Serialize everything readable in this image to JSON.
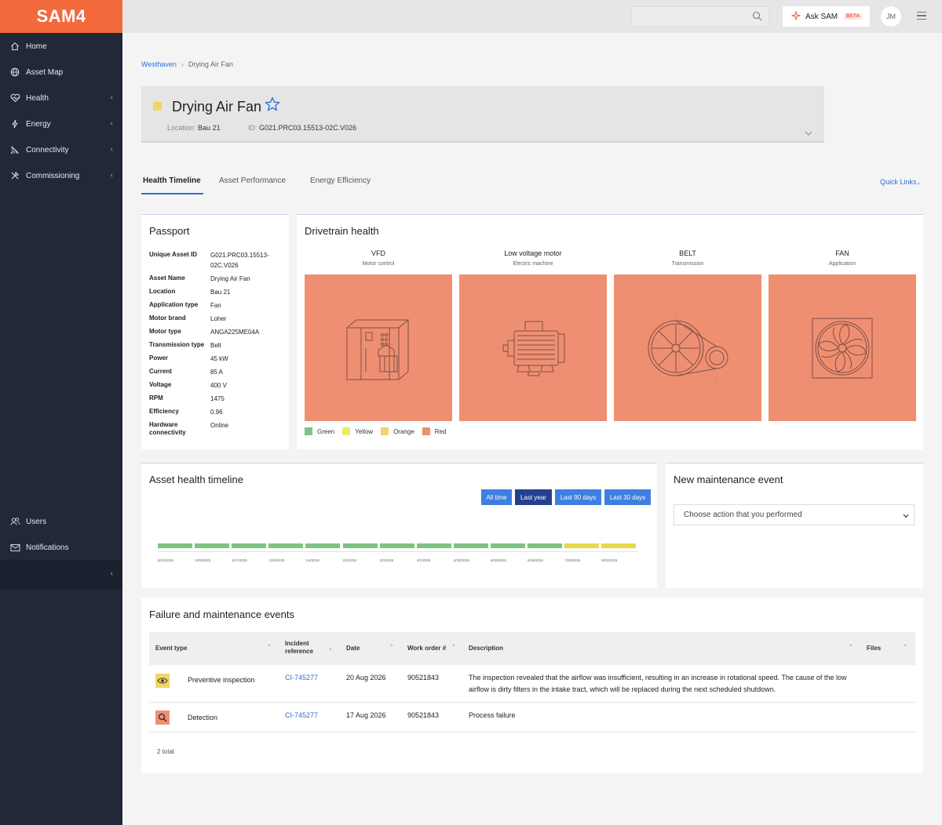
{
  "app": {
    "logo": "SAM4"
  },
  "sidebar": {
    "items": [
      {
        "label": "Home",
        "icon": "home-icon",
        "has_chevron": false
      },
      {
        "label": "Asset Map",
        "icon": "globe-icon",
        "has_chevron": false
      },
      {
        "label": "Health",
        "icon": "heart-pulse-icon",
        "has_chevron": true
      },
      {
        "label": "Energy",
        "icon": "lightning-icon",
        "has_chevron": true
      },
      {
        "label": "Connectivity",
        "icon": "signal-icon",
        "has_chevron": true
      },
      {
        "label": "Commissioning",
        "icon": "tools-icon",
        "has_chevron": true
      }
    ],
    "bottom_items": [
      {
        "label": "Users",
        "icon": "users-icon"
      },
      {
        "label": "Notifications",
        "icon": "mail-icon"
      }
    ],
    "chevron": "‹"
  },
  "topbar": {
    "search_placeholder": "",
    "ask_label": "Ask SAM",
    "beta_badge": "BETA",
    "avatar_initials": "JM"
  },
  "breadcrumb": {
    "parent": "Westhaven",
    "current": "Drying Air Fan"
  },
  "asset": {
    "status_color": "#f1d469",
    "name": "Drying Air Fan",
    "location_label": "Location:",
    "location_value": "Bau 21",
    "id_label": "ID:",
    "id_value": "G021.PRC03.15513-02C.V026"
  },
  "tabs": [
    "Health Timeline",
    "Asset Performance",
    "Energy Efficiency"
  ],
  "quick_links": "Quick Links",
  "passport": {
    "title": "Passport",
    "rows": [
      {
        "label": "Unique Asset ID",
        "value": "G021.PRC03.15513-02C.V026"
      },
      {
        "label": "Asset Name",
        "value": "Drying Air Fan"
      },
      {
        "label": "Location",
        "value": "Bau 21"
      },
      {
        "label": "Application type",
        "value": "Fan"
      },
      {
        "label": "Motor brand",
        "value": "Loher"
      },
      {
        "label": "Motor type",
        "value": "ANGA225ME04A"
      },
      {
        "label": "Transmission type",
        "value": "Belt"
      },
      {
        "label": "Power",
        "value": "45 kW"
      },
      {
        "label": "Current",
        "value": "85 A"
      },
      {
        "label": "Voltage",
        "value": "400 V"
      },
      {
        "label": "RPM",
        "value": "1475"
      },
      {
        "label": "Efficiency",
        "value": "0.96"
      },
      {
        "label": "Hardware connectivity",
        "value": "Online"
      }
    ]
  },
  "drivetrain": {
    "title": "Drivetrain health",
    "components": [
      {
        "name": "VFD",
        "sub": "Motor control",
        "icon": "vfd-cabinet-icon",
        "status": "Red"
      },
      {
        "name": "Low voltage motor",
        "sub": "Electric machine",
        "icon": "electric-motor-icon",
        "status": "Red"
      },
      {
        "name": "BELT",
        "sub": "Transmission",
        "icon": "belt-pulley-icon",
        "status": "Red"
      },
      {
        "name": "FAN",
        "sub": "Application",
        "icon": "fan-icon",
        "status": "Red"
      }
    ],
    "legend": [
      {
        "label": "Green",
        "color": "#7cc47f"
      },
      {
        "label": "Yellow",
        "color": "#eee86a"
      },
      {
        "label": "Orange",
        "color": "#f1d469"
      },
      {
        "label": "Red",
        "color": "#ef8f72"
      }
    ]
  },
  "timeline": {
    "title": "Asset health timeline",
    "ranges": [
      "All time",
      "Last year",
      "Last 90 days",
      "Last 30 days"
    ],
    "selected_range": "Last year",
    "periods": [
      {
        "date": "8/10/2025",
        "status": "Green"
      },
      {
        "date": "10/9/2025",
        "status": "Green"
      },
      {
        "date": "11/7/2025",
        "status": "Green"
      },
      {
        "date": "12/6/2025",
        "status": "Green"
      },
      {
        "date": "1/4/2026",
        "status": "Green"
      },
      {
        "date": "2/2/2026",
        "status": "Green"
      },
      {
        "date": "3/3/2026",
        "status": "Green"
      },
      {
        "date": "4/1/2026",
        "status": "Green"
      },
      {
        "date": "4/30/2026",
        "status": "Green"
      },
      {
        "date": "5/29/2026",
        "status": "Green"
      },
      {
        "date": "6/28/2026",
        "status": "Green"
      },
      {
        "date": "7/26/2026",
        "status": "Yellow"
      },
      {
        "date": "8/22/2026",
        "status": "Yellow"
      }
    ]
  },
  "maintenance": {
    "title": "New maintenance event",
    "select_placeholder": "Choose action that you performed"
  },
  "events": {
    "title": "Failure and maintenance events",
    "columns": [
      "Event type",
      "Incident reference",
      "Date",
      "Work order #",
      "Description",
      "Files"
    ],
    "rows": [
      {
        "icon": "eye-icon",
        "icon_bg": "#f1d469",
        "type": "Preventive inspection",
        "ref": "CI-745277",
        "date": "20 Aug 2026",
        "work_order": "90521843",
        "description": "The inspection revealed that the airflow was insufficient, resulting in an increase in rotational speed. The cause of the low airflow is dirty filters in the intake tract, which will be replaced during the next scheduled shutdown."
      },
      {
        "icon": "magnifier-icon",
        "icon_bg": "#ef8f72",
        "type": "Detection",
        "ref": "CI-745277",
        "date": "17 Aug 2026",
        "work_order": "90521843",
        "description": "Process failure"
      }
    ],
    "total": "2 total"
  }
}
